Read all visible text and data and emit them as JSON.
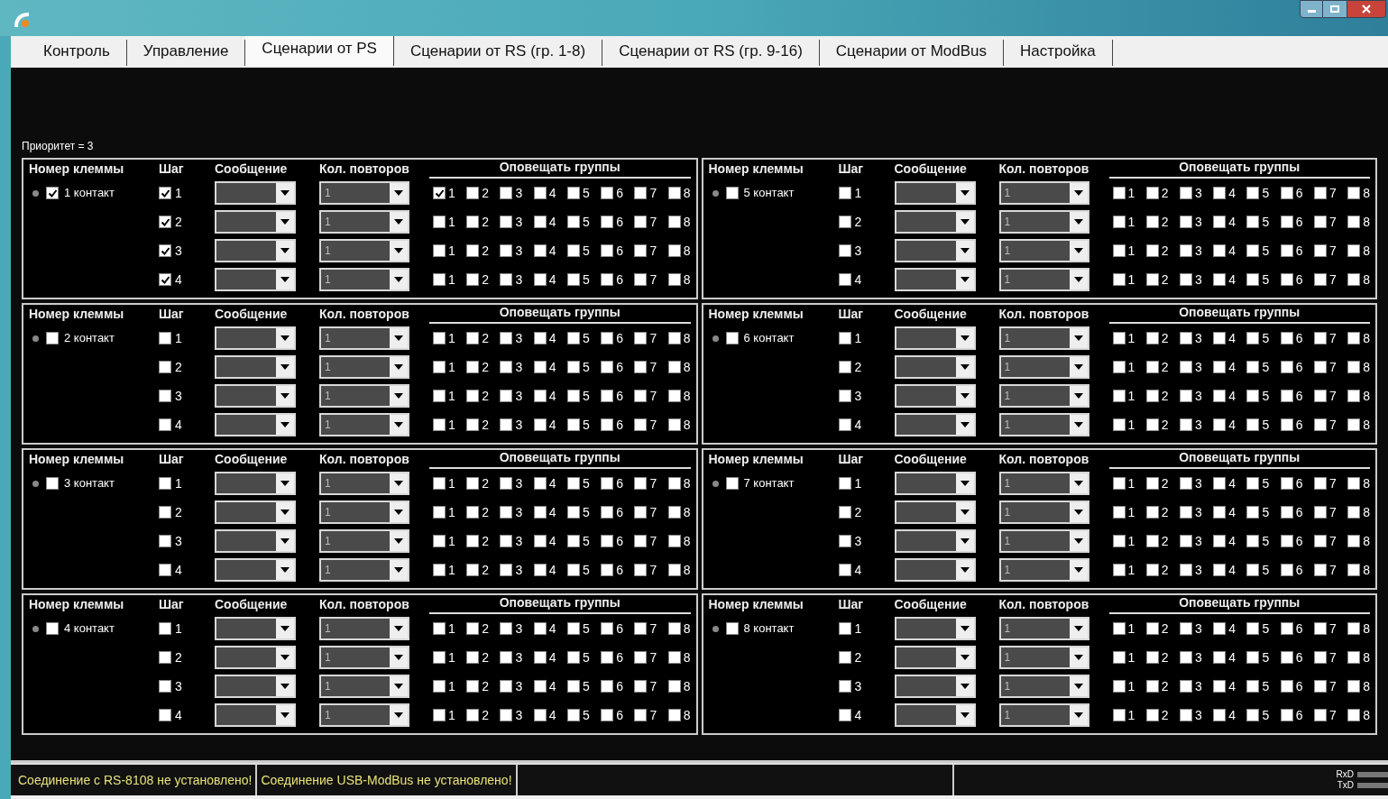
{
  "tabs": [
    {
      "label": "Контроль",
      "selected": false
    },
    {
      "label": "Управление",
      "selected": false
    },
    {
      "label": "Сценарии от PS",
      "selected": true
    },
    {
      "label": "Сценарии от RS (гр. 1-8)",
      "selected": false
    },
    {
      "label": "Сценарии от RS (гр. 9-16)",
      "selected": false
    },
    {
      "label": "Сценарии от ModBus",
      "selected": false
    },
    {
      "label": "Настройка",
      "selected": false
    }
  ],
  "priority": "Приоритет = 3",
  "panels": [
    {
      "columns": [
        "Номер клеммы",
        "Шаг",
        "Сообщение",
        "Кол. повторов",
        "Оповещать группы"
      ],
      "contact": {
        "label": "1 контакт",
        "checked": true
      },
      "steps": [
        {
          "label": "1",
          "checked": true,
          "repeats": "1",
          "groups": [
            {
              "label": "1",
              "checked": true
            },
            {
              "label": "2",
              "checked": false
            },
            {
              "label": "3",
              "checked": false
            },
            {
              "label": "4",
              "checked": false
            },
            {
              "label": "5",
              "checked": false
            },
            {
              "label": "6",
              "checked": false
            },
            {
              "label": "7",
              "checked": false
            },
            {
              "label": "8",
              "checked": false
            }
          ]
        },
        {
          "label": "2",
          "checked": true,
          "repeats": "1",
          "groups": [
            {
              "label": "1",
              "checked": false
            },
            {
              "label": "2",
              "checked": false
            },
            {
              "label": "3",
              "checked": false
            },
            {
              "label": "4",
              "checked": false
            },
            {
              "label": "5",
              "checked": false
            },
            {
              "label": "6",
              "checked": false
            },
            {
              "label": "7",
              "checked": false
            },
            {
              "label": "8",
              "checked": false
            }
          ]
        },
        {
          "label": "3",
          "checked": true,
          "repeats": "1",
          "groups": [
            {
              "label": "1",
              "checked": false
            },
            {
              "label": "2",
              "checked": false
            },
            {
              "label": "3",
              "checked": false
            },
            {
              "label": "4",
              "checked": false
            },
            {
              "label": "5",
              "checked": false
            },
            {
              "label": "6",
              "checked": false
            },
            {
              "label": "7",
              "checked": false
            },
            {
              "label": "8",
              "checked": false
            }
          ]
        },
        {
          "label": "4",
          "checked": true,
          "repeats": "1",
          "groups": [
            {
              "label": "1",
              "checked": false
            },
            {
              "label": "2",
              "checked": false
            },
            {
              "label": "3",
              "checked": false
            },
            {
              "label": "4",
              "checked": false
            },
            {
              "label": "5",
              "checked": false
            },
            {
              "label": "6",
              "checked": false
            },
            {
              "label": "7",
              "checked": false
            },
            {
              "label": "8",
              "checked": false
            }
          ]
        }
      ]
    },
    {
      "columns": [
        "Номер клеммы",
        "Шаг",
        "Сообщение",
        "Кол. повторов",
        "Оповещать группы"
      ],
      "contact": {
        "label": "5 контакт",
        "checked": false
      },
      "steps": [
        {
          "label": "1",
          "checked": false,
          "repeats": "1",
          "groups": [
            {
              "label": "1",
              "checked": false
            },
            {
              "label": "2",
              "checked": false
            },
            {
              "label": "3",
              "checked": false
            },
            {
              "label": "4",
              "checked": false
            },
            {
              "label": "5",
              "checked": false
            },
            {
              "label": "6",
              "checked": false
            },
            {
              "label": "7",
              "checked": false
            },
            {
              "label": "8",
              "checked": false
            }
          ]
        },
        {
          "label": "2",
          "checked": false,
          "repeats": "1",
          "groups": [
            {
              "label": "1",
              "checked": false
            },
            {
              "label": "2",
              "checked": false
            },
            {
              "label": "3",
              "checked": false
            },
            {
              "label": "4",
              "checked": false
            },
            {
              "label": "5",
              "checked": false
            },
            {
              "label": "6",
              "checked": false
            },
            {
              "label": "7",
              "checked": false
            },
            {
              "label": "8",
              "checked": false
            }
          ]
        },
        {
          "label": "3",
          "checked": false,
          "repeats": "1",
          "groups": [
            {
              "label": "1",
              "checked": false
            },
            {
              "label": "2",
              "checked": false
            },
            {
              "label": "3",
              "checked": false
            },
            {
              "label": "4",
              "checked": false
            },
            {
              "label": "5",
              "checked": false
            },
            {
              "label": "6",
              "checked": false
            },
            {
              "label": "7",
              "checked": false
            },
            {
              "label": "8",
              "checked": false
            }
          ]
        },
        {
          "label": "4",
          "checked": false,
          "repeats": "1",
          "groups": [
            {
              "label": "1",
              "checked": false
            },
            {
              "label": "2",
              "checked": false
            },
            {
              "label": "3",
              "checked": false
            },
            {
              "label": "4",
              "checked": false
            },
            {
              "label": "5",
              "checked": false
            },
            {
              "label": "6",
              "checked": false
            },
            {
              "label": "7",
              "checked": false
            },
            {
              "label": "8",
              "checked": false
            }
          ]
        }
      ]
    },
    {
      "columns": [
        "Номер клеммы",
        "Шаг",
        "Сообщение",
        "Кол. повторов",
        "Оповещать группы"
      ],
      "contact": {
        "label": "2 контакт",
        "checked": false
      },
      "steps": [
        {
          "label": "1",
          "checked": false,
          "repeats": "1",
          "groups": [
            {
              "label": "1",
              "checked": false
            },
            {
              "label": "2",
              "checked": false
            },
            {
              "label": "3",
              "checked": false
            },
            {
              "label": "4",
              "checked": false
            },
            {
              "label": "5",
              "checked": false
            },
            {
              "label": "6",
              "checked": false
            },
            {
              "label": "7",
              "checked": false
            },
            {
              "label": "8",
              "checked": false
            }
          ]
        },
        {
          "label": "2",
          "checked": false,
          "repeats": "1",
          "groups": [
            {
              "label": "1",
              "checked": false
            },
            {
              "label": "2",
              "checked": false
            },
            {
              "label": "3",
              "checked": false
            },
            {
              "label": "4",
              "checked": false
            },
            {
              "label": "5",
              "checked": false
            },
            {
              "label": "6",
              "checked": false
            },
            {
              "label": "7",
              "checked": false
            },
            {
              "label": "8",
              "checked": false
            }
          ]
        },
        {
          "label": "3",
          "checked": false,
          "repeats": "1",
          "groups": [
            {
              "label": "1",
              "checked": false
            },
            {
              "label": "2",
              "checked": false
            },
            {
              "label": "3",
              "checked": false
            },
            {
              "label": "4",
              "checked": false
            },
            {
              "label": "5",
              "checked": false
            },
            {
              "label": "6",
              "checked": false
            },
            {
              "label": "7",
              "checked": false
            },
            {
              "label": "8",
              "checked": false
            }
          ]
        },
        {
          "label": "4",
          "checked": false,
          "repeats": "1",
          "groups": [
            {
              "label": "1",
              "checked": false
            },
            {
              "label": "2",
              "checked": false
            },
            {
              "label": "3",
              "checked": false
            },
            {
              "label": "4",
              "checked": false
            },
            {
              "label": "5",
              "checked": false
            },
            {
              "label": "6",
              "checked": false
            },
            {
              "label": "7",
              "checked": false
            },
            {
              "label": "8",
              "checked": false
            }
          ]
        }
      ]
    },
    {
      "columns": [
        "Номер клеммы",
        "Шаг",
        "Сообщение",
        "Кол. повторов",
        "Оповещать группы"
      ],
      "contact": {
        "label": "6 контакт",
        "checked": false
      },
      "steps": [
        {
          "label": "1",
          "checked": false,
          "repeats": "1",
          "groups": [
            {
              "label": "1",
              "checked": false
            },
            {
              "label": "2",
              "checked": false
            },
            {
              "label": "3",
              "checked": false
            },
            {
              "label": "4",
              "checked": false
            },
            {
              "label": "5",
              "checked": false
            },
            {
              "label": "6",
              "checked": false
            },
            {
              "label": "7",
              "checked": false
            },
            {
              "label": "8",
              "checked": false
            }
          ]
        },
        {
          "label": "2",
          "checked": false,
          "repeats": "1",
          "groups": [
            {
              "label": "1",
              "checked": false
            },
            {
              "label": "2",
              "checked": false
            },
            {
              "label": "3",
              "checked": false
            },
            {
              "label": "4",
              "checked": false
            },
            {
              "label": "5",
              "checked": false
            },
            {
              "label": "6",
              "checked": false
            },
            {
              "label": "7",
              "checked": false
            },
            {
              "label": "8",
              "checked": false
            }
          ]
        },
        {
          "label": "3",
          "checked": false,
          "repeats": "1",
          "groups": [
            {
              "label": "1",
              "checked": false
            },
            {
              "label": "2",
              "checked": false
            },
            {
              "label": "3",
              "checked": false
            },
            {
              "label": "4",
              "checked": false
            },
            {
              "label": "5",
              "checked": false
            },
            {
              "label": "6",
              "checked": false
            },
            {
              "label": "7",
              "checked": false
            },
            {
              "label": "8",
              "checked": false
            }
          ]
        },
        {
          "label": "4",
          "checked": false,
          "repeats": "1",
          "groups": [
            {
              "label": "1",
              "checked": false
            },
            {
              "label": "2",
              "checked": false
            },
            {
              "label": "3",
              "checked": false
            },
            {
              "label": "4",
              "checked": false
            },
            {
              "label": "5",
              "checked": false
            },
            {
              "label": "6",
              "checked": false
            },
            {
              "label": "7",
              "checked": false
            },
            {
              "label": "8",
              "checked": false
            }
          ]
        }
      ]
    },
    {
      "columns": [
        "Номер клеммы",
        "Шаг",
        "Сообщение",
        "Кол. повторов",
        "Оповещать группы"
      ],
      "contact": {
        "label": "3 контакт",
        "checked": false
      },
      "steps": [
        {
          "label": "1",
          "checked": false,
          "repeats": "1",
          "groups": [
            {
              "label": "1",
              "checked": false
            },
            {
              "label": "2",
              "checked": false
            },
            {
              "label": "3",
              "checked": false
            },
            {
              "label": "4",
              "checked": false
            },
            {
              "label": "5",
              "checked": false
            },
            {
              "label": "6",
              "checked": false
            },
            {
              "label": "7",
              "checked": false
            },
            {
              "label": "8",
              "checked": false
            }
          ]
        },
        {
          "label": "2",
          "checked": false,
          "repeats": "1",
          "groups": [
            {
              "label": "1",
              "checked": false
            },
            {
              "label": "2",
              "checked": false
            },
            {
              "label": "3",
              "checked": false
            },
            {
              "label": "4",
              "checked": false
            },
            {
              "label": "5",
              "checked": false
            },
            {
              "label": "6",
              "checked": false
            },
            {
              "label": "7",
              "checked": false
            },
            {
              "label": "8",
              "checked": false
            }
          ]
        },
        {
          "label": "3",
          "checked": false,
          "repeats": "1",
          "groups": [
            {
              "label": "1",
              "checked": false
            },
            {
              "label": "2",
              "checked": false
            },
            {
              "label": "3",
              "checked": false
            },
            {
              "label": "4",
              "checked": false
            },
            {
              "label": "5",
              "checked": false
            },
            {
              "label": "6",
              "checked": false
            },
            {
              "label": "7",
              "checked": false
            },
            {
              "label": "8",
              "checked": false
            }
          ]
        },
        {
          "label": "4",
          "checked": false,
          "repeats": "1",
          "groups": [
            {
              "label": "1",
              "checked": false
            },
            {
              "label": "2",
              "checked": false
            },
            {
              "label": "3",
              "checked": false
            },
            {
              "label": "4",
              "checked": false
            },
            {
              "label": "5",
              "checked": false
            },
            {
              "label": "6",
              "checked": false
            },
            {
              "label": "7",
              "checked": false
            },
            {
              "label": "8",
              "checked": false
            }
          ]
        }
      ]
    },
    {
      "columns": [
        "Номер клеммы",
        "Шаг",
        "Сообщение",
        "Кол. повторов",
        "Оповещать группы"
      ],
      "contact": {
        "label": "7 контакт",
        "checked": false
      },
      "steps": [
        {
          "label": "1",
          "checked": false,
          "repeats": "1",
          "groups": [
            {
              "label": "1",
              "checked": false
            },
            {
              "label": "2",
              "checked": false
            },
            {
              "label": "3",
              "checked": false
            },
            {
              "label": "4",
              "checked": false
            },
            {
              "label": "5",
              "checked": false
            },
            {
              "label": "6",
              "checked": false
            },
            {
              "label": "7",
              "checked": false
            },
            {
              "label": "8",
              "checked": false
            }
          ]
        },
        {
          "label": "2",
          "checked": false,
          "repeats": "1",
          "groups": [
            {
              "label": "1",
              "checked": false
            },
            {
              "label": "2",
              "checked": false
            },
            {
              "label": "3",
              "checked": false
            },
            {
              "label": "4",
              "checked": false
            },
            {
              "label": "5",
              "checked": false
            },
            {
              "label": "6",
              "checked": false
            },
            {
              "label": "7",
              "checked": false
            },
            {
              "label": "8",
              "checked": false
            }
          ]
        },
        {
          "label": "3",
          "checked": false,
          "repeats": "1",
          "groups": [
            {
              "label": "1",
              "checked": false
            },
            {
              "label": "2",
              "checked": false
            },
            {
              "label": "3",
              "checked": false
            },
            {
              "label": "4",
              "checked": false
            },
            {
              "label": "5",
              "checked": false
            },
            {
              "label": "6",
              "checked": false
            },
            {
              "label": "7",
              "checked": false
            },
            {
              "label": "8",
              "checked": false
            }
          ]
        },
        {
          "label": "4",
          "checked": false,
          "repeats": "1",
          "groups": [
            {
              "label": "1",
              "checked": false
            },
            {
              "label": "2",
              "checked": false
            },
            {
              "label": "3",
              "checked": false
            },
            {
              "label": "4",
              "checked": false
            },
            {
              "label": "5",
              "checked": false
            },
            {
              "label": "6",
              "checked": false
            },
            {
              "label": "7",
              "checked": false
            },
            {
              "label": "8",
              "checked": false
            }
          ]
        }
      ]
    },
    {
      "columns": [
        "Номер клеммы",
        "Шаг",
        "Сообщение",
        "Кол. повторов",
        "Оповещать группы"
      ],
      "contact": {
        "label": "4 контакт",
        "checked": false
      },
      "steps": [
        {
          "label": "1",
          "checked": false,
          "repeats": "1",
          "groups": [
            {
              "label": "1",
              "checked": false
            },
            {
              "label": "2",
              "checked": false
            },
            {
              "label": "3",
              "checked": false
            },
            {
              "label": "4",
              "checked": false
            },
            {
              "label": "5",
              "checked": false
            },
            {
              "label": "6",
              "checked": false
            },
            {
              "label": "7",
              "checked": false
            },
            {
              "label": "8",
              "checked": false
            }
          ]
        },
        {
          "label": "2",
          "checked": false,
          "repeats": "1",
          "groups": [
            {
              "label": "1",
              "checked": false
            },
            {
              "label": "2",
              "checked": false
            },
            {
              "label": "3",
              "checked": false
            },
            {
              "label": "4",
              "checked": false
            },
            {
              "label": "5",
              "checked": false
            },
            {
              "label": "6",
              "checked": false
            },
            {
              "label": "7",
              "checked": false
            },
            {
              "label": "8",
              "checked": false
            }
          ]
        },
        {
          "label": "3",
          "checked": false,
          "repeats": "1",
          "groups": [
            {
              "label": "1",
              "checked": false
            },
            {
              "label": "2",
              "checked": false
            },
            {
              "label": "3",
              "checked": false
            },
            {
              "label": "4",
              "checked": false
            },
            {
              "label": "5",
              "checked": false
            },
            {
              "label": "6",
              "checked": false
            },
            {
              "label": "7",
              "checked": false
            },
            {
              "label": "8",
              "checked": false
            }
          ]
        },
        {
          "label": "4",
          "checked": false,
          "repeats": "1",
          "groups": [
            {
              "label": "1",
              "checked": false
            },
            {
              "label": "2",
              "checked": false
            },
            {
              "label": "3",
              "checked": false
            },
            {
              "label": "4",
              "checked": false
            },
            {
              "label": "5",
              "checked": false
            },
            {
              "label": "6",
              "checked": false
            },
            {
              "label": "7",
              "checked": false
            },
            {
              "label": "8",
              "checked": false
            }
          ]
        }
      ]
    },
    {
      "columns": [
        "Номер клеммы",
        "Шаг",
        "Сообщение",
        "Кол. повторов",
        "Оповещать группы"
      ],
      "contact": {
        "label": "8 контакт",
        "checked": false
      },
      "steps": [
        {
          "label": "1",
          "checked": false,
          "repeats": "1",
          "groups": [
            {
              "label": "1",
              "checked": false
            },
            {
              "label": "2",
              "checked": false
            },
            {
              "label": "3",
              "checked": false
            },
            {
              "label": "4",
              "checked": false
            },
            {
              "label": "5",
              "checked": false
            },
            {
              "label": "6",
              "checked": false
            },
            {
              "label": "7",
              "checked": false
            },
            {
              "label": "8",
              "checked": false
            }
          ]
        },
        {
          "label": "2",
          "checked": false,
          "repeats": "1",
          "groups": [
            {
              "label": "1",
              "checked": false
            },
            {
              "label": "2",
              "checked": false
            },
            {
              "label": "3",
              "checked": false
            },
            {
              "label": "4",
              "checked": false
            },
            {
              "label": "5",
              "checked": false
            },
            {
              "label": "6",
              "checked": false
            },
            {
              "label": "7",
              "checked": false
            },
            {
              "label": "8",
              "checked": false
            }
          ]
        },
        {
          "label": "3",
          "checked": false,
          "repeats": "1",
          "groups": [
            {
              "label": "1",
              "checked": false
            },
            {
              "label": "2",
              "checked": false
            },
            {
              "label": "3",
              "checked": false
            },
            {
              "label": "4",
              "checked": false
            },
            {
              "label": "5",
              "checked": false
            },
            {
              "label": "6",
              "checked": false
            },
            {
              "label": "7",
              "checked": false
            },
            {
              "label": "8",
              "checked": false
            }
          ]
        },
        {
          "label": "4",
          "checked": false,
          "repeats": "1",
          "groups": [
            {
              "label": "1",
              "checked": false
            },
            {
              "label": "2",
              "checked": false
            },
            {
              "label": "3",
              "checked": false
            },
            {
              "label": "4",
              "checked": false
            },
            {
              "label": "5",
              "checked": false
            },
            {
              "label": "6",
              "checked": false
            },
            {
              "label": "7",
              "checked": false
            },
            {
              "label": "8",
              "checked": false
            }
          ]
        }
      ]
    }
  ],
  "status_bar": {
    "messages": [
      "Соединение с RS-8108 не установлено!",
      "Соединение USB-ModBus не установлено!"
    ],
    "indicators": [
      "RxD",
      "TxD"
    ]
  }
}
